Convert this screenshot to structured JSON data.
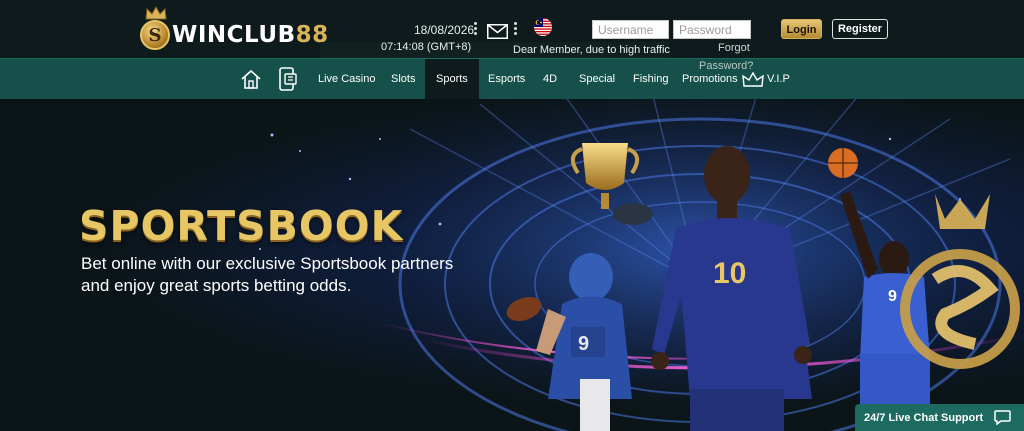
{
  "brand": {
    "name_prefix": "WINCLUB",
    "name_suffix": "88",
    "logo_letter": "S"
  },
  "header": {
    "date": "18/08/2026",
    "time": "07:14:08  (GMT+8)",
    "announcement": "Dear Member, due to high traffic",
    "username_placeholder": "Username",
    "password_placeholder": "Password",
    "forgot_label": "Forgot",
    "forgot_label_2": "Password?",
    "login_label": "Login",
    "register_label": "Register",
    "icons": [
      "mail-icon",
      "flag-icon"
    ]
  },
  "nav": {
    "items": [
      {
        "label": "Live Casino",
        "active": false
      },
      {
        "label": "Slots",
        "active": false
      },
      {
        "label": "Sports",
        "active": true
      },
      {
        "label": "Esports",
        "active": false
      },
      {
        "label": "4D",
        "active": false
      },
      {
        "label": "Special",
        "active": false
      },
      {
        "label": "Fishing",
        "active": false
      },
      {
        "label": "Promotions",
        "active": false
      },
      {
        "label": "V.I.P",
        "active": false
      }
    ],
    "icons": [
      "home-icon",
      "mobile-app-icon",
      "crown-icon"
    ]
  },
  "hero": {
    "title": "SPORTSBOOK",
    "subtitle_line1": "Bet online with our exclusive Sportsbook partners",
    "subtitle_line2": "and enjoy great sports betting odds.",
    "jersey_numbers": [
      "9",
      "10",
      "9"
    ]
  },
  "chat": {
    "label": "24/7 Live Chat Support"
  },
  "colors": {
    "nav_bg": "#15504a",
    "header_bg": "#0e1a1c",
    "gold": "#e7c765",
    "accent_blue": "#2f4fbf"
  }
}
